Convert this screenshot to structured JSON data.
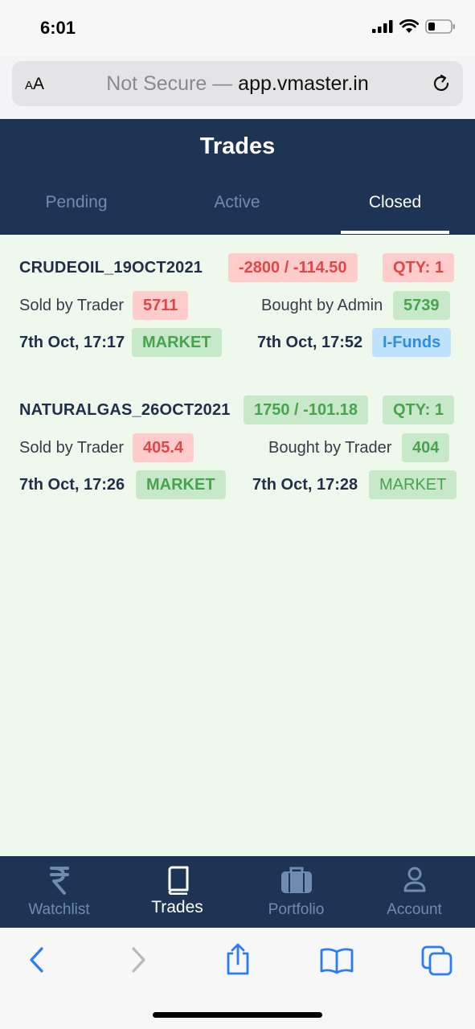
{
  "status_bar": {
    "time": "6:01"
  },
  "url_bar": {
    "aa_small": "A",
    "aa_large": "A",
    "insecure": "Not Secure — ",
    "domain": "app.vmaster.in"
  },
  "header": {
    "title": "Trades"
  },
  "tabs": [
    {
      "label": "Pending",
      "active": false
    },
    {
      "label": "Active",
      "active": false
    },
    {
      "label": "Closed",
      "active": true
    }
  ],
  "trades": [
    {
      "symbol": "CRUDEOIL_19OCT2021",
      "pnl": "-2800 / -114.50",
      "qty": "QTY: 1",
      "sell_label": "Sold by Trader",
      "sell_price": "5711",
      "buy_label": "Bought by Admin",
      "buy_price": "5739",
      "sell_time": "7th Oct, 17:17",
      "sell_type": "MARKET",
      "buy_time": "7th Oct, 17:52",
      "buy_type": "I-Funds"
    },
    {
      "symbol": "NATURALGAS_26OCT2021",
      "pnl": "1750 / -101.18",
      "qty": "QTY: 1",
      "sell_label": "Sold by Trader",
      "sell_price": "405.4",
      "buy_label": "Bought by Trader",
      "buy_price": "404",
      "sell_time": "7th Oct, 17:26",
      "sell_type": "MARKET",
      "buy_time": "7th Oct, 17:28",
      "buy_type": "MARKET"
    }
  ],
  "bottom_nav": [
    {
      "label": "Watchlist",
      "icon": "rupee-icon",
      "active": false
    },
    {
      "label": "Trades",
      "icon": "book-icon",
      "active": true
    },
    {
      "label": "Portfolio",
      "icon": "briefcase-icon",
      "active": false
    },
    {
      "label": "Account",
      "icon": "person-icon",
      "active": false
    }
  ],
  "colors": {
    "header_bg": "#1e3454",
    "content_bg": "#eff8ec",
    "loss_red": "#e04848",
    "profit_green": "#48a44c",
    "info_blue": "#2a8de6"
  }
}
